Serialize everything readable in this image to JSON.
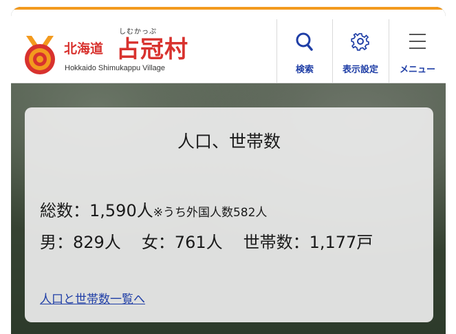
{
  "header": {
    "prefecture": "北海道",
    "village_ruby": "しむかっぷ",
    "village_name": "占冠村",
    "english_name": "Hokkaido Shimukappu Village",
    "search_label": "検索",
    "search_icon": "search-icon",
    "display_settings_label": "表示設定",
    "display_settings_icon": "gear-icon",
    "menu_label": "メニュー",
    "menu_icon": "hamburger-icon"
  },
  "colors": {
    "accent_orange": "#f39a1e",
    "brand_red": "#d8322e",
    "nav_blue": "#1f3ea6"
  },
  "population_card": {
    "title": "人口、世帯数",
    "total_label": "総数：",
    "total_value": "1,590人",
    "foreign_note": "※うち外国人数582人",
    "male": "男：829人",
    "female": "女：761人",
    "households": "世帯数：1,177戸",
    "list_link": "人口と世帯数一覧へ"
  }
}
